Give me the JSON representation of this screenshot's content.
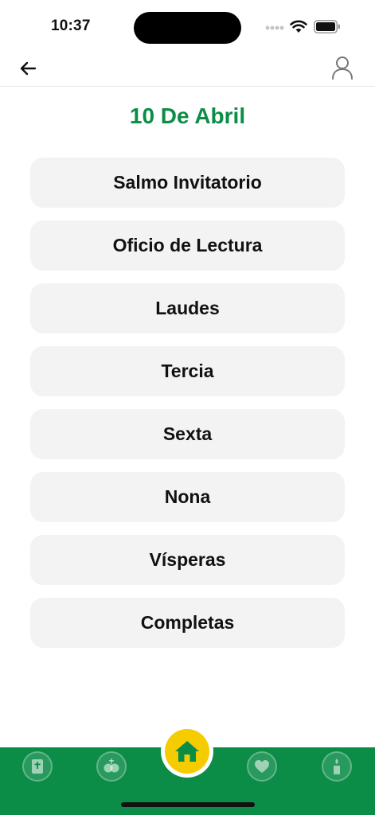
{
  "status_bar": {
    "time": "10:37"
  },
  "header": {
    "back_icon": "arrow-left-icon",
    "profile_icon": "user-icon"
  },
  "page": {
    "title": "10 De Abril"
  },
  "hours": [
    {
      "label": "Salmo Invitatorio"
    },
    {
      "label": "Oficio de Lectura"
    },
    {
      "label": "Laudes"
    },
    {
      "label": "Tercia"
    },
    {
      "label": "Sexta"
    },
    {
      "label": "Nona"
    },
    {
      "label": "Vísperas"
    },
    {
      "label": "Completas"
    }
  ],
  "tab_bar": {
    "tabs": [
      {
        "icon": "bible-icon"
      },
      {
        "icon": "rosary-icon"
      },
      {
        "icon": "home-icon",
        "active": true
      },
      {
        "icon": "heart-icon"
      },
      {
        "icon": "candle-icon"
      }
    ]
  },
  "colors": {
    "accent": "#0b8c47",
    "tab_bar": "#0b8c47",
    "home_highlight": "#f5cc00",
    "button_bg": "#f3f3f3"
  }
}
